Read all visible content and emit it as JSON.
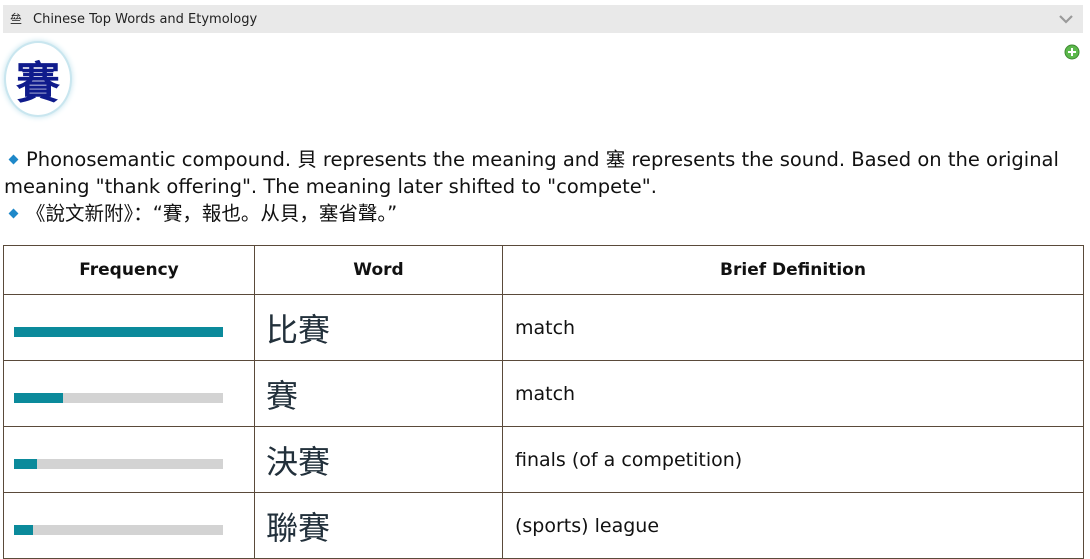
{
  "app": {
    "title": "Chinese Top Words and Etymology",
    "icon": "app-glyph-icon",
    "icon_glyph": "亝"
  },
  "character": "賽",
  "etymology": {
    "line1": "Phonosemantic compound. 貝 represents the meaning and 塞 represents the sound. Based on the original meaning \"thank offering\". The meaning later shifted to \"compete\".",
    "line2": "《說文新附》：“賽，報也。从貝，塞省聲。”"
  },
  "table": {
    "headers": {
      "frequency": "Frequency",
      "word": "Word",
      "definition": "Brief Definition"
    },
    "rows": [
      {
        "word": "比賽",
        "definition": "match",
        "frequency": 1.0
      },
      {
        "word": "賽",
        "definition": "match",
        "frequency": 0.235
      },
      {
        "word": "決賽",
        "definition": "finals (of a competition)",
        "frequency": 0.11
      },
      {
        "word": "聯賽",
        "definition": "(sports) league",
        "frequency": 0.09
      }
    ]
  },
  "colors": {
    "accent": "#0b8a9b",
    "bar_track": "#d3d3d3",
    "badge_text": "#0f1b8c",
    "bullet": "#1e88c9"
  }
}
